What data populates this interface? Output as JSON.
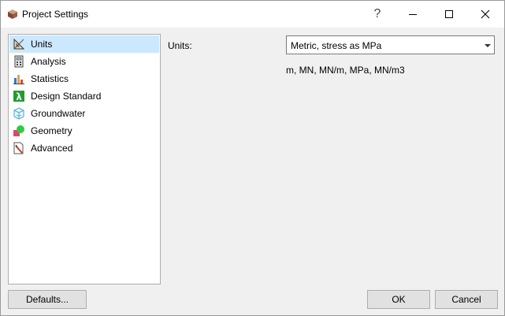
{
  "window": {
    "title": "Project Settings",
    "help_label": "?"
  },
  "nav": {
    "items": [
      {
        "label": "Units",
        "icon": "set-square-icon",
        "selected": true
      },
      {
        "label": "Analysis",
        "icon": "calculator-icon",
        "selected": false
      },
      {
        "label": "Statistics",
        "icon": "bar-chart-icon",
        "selected": false
      },
      {
        "label": "Design Standard",
        "icon": "lambda-icon",
        "selected": false
      },
      {
        "label": "Groundwater",
        "icon": "water-cube-icon",
        "selected": false
      },
      {
        "label": "Geometry",
        "icon": "shapes-icon",
        "selected": false
      },
      {
        "label": "Advanced",
        "icon": "pencil-page-icon",
        "selected": false
      }
    ]
  },
  "units": {
    "label": "Units:",
    "selected_value": "Metric, stress as MPa",
    "description": "m, MN, MN/m, MPa, MN/m3"
  },
  "buttons": {
    "defaults": "Defaults...",
    "ok": "OK",
    "cancel": "Cancel"
  },
  "colors": {
    "selection": "#cce8ff",
    "lambda_green": "#1f9d2f",
    "geometry_green": "#2ecc40"
  }
}
